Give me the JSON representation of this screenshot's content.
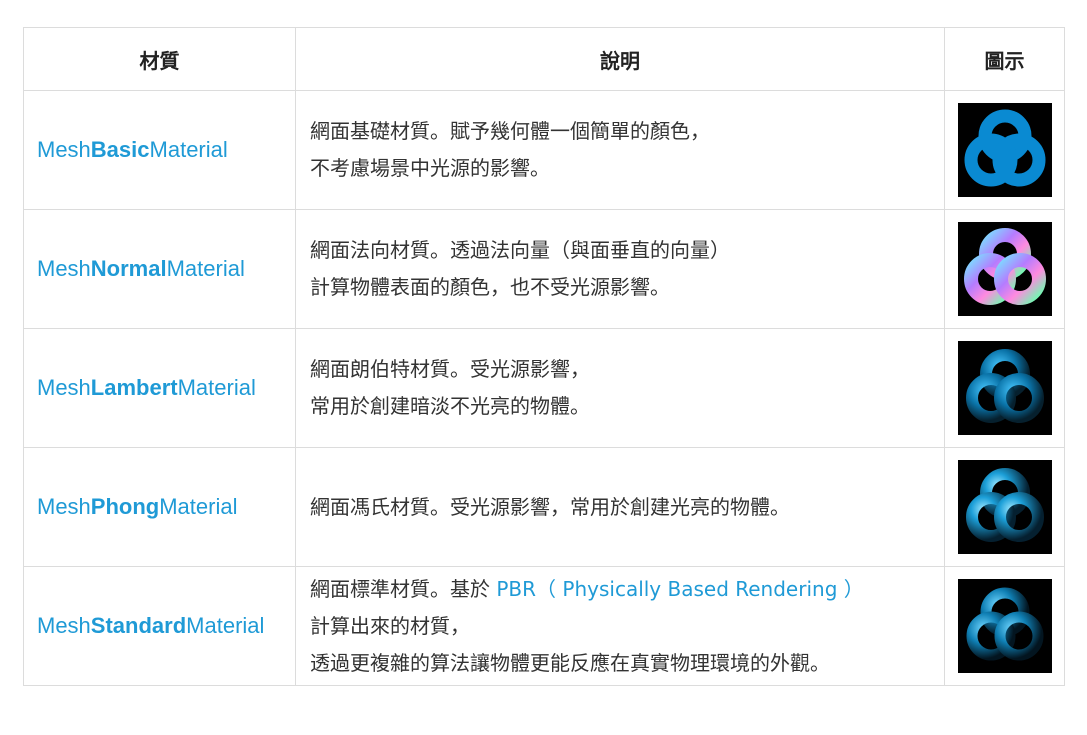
{
  "headers": {
    "material": "材質",
    "description": "說明",
    "image": "圖示"
  },
  "rows": [
    {
      "name_prefix": "Mesh",
      "name_bold": "Basic",
      "name_suffix": "Material",
      "desc_lines": [
        "網面基礎材質。賦予幾何體一個簡單的顏色，",
        "不考慮場景中光源的影響。"
      ],
      "image_icon": "torus-knot-basic-icon"
    },
    {
      "name_prefix": "Mesh",
      "name_bold": "Normal",
      "name_suffix": "Material",
      "desc_lines": [
        "網面法向材質。透過法向量（與面垂直的向量）",
        "計算物體表面的顏色，也不受光源影響。"
      ],
      "image_icon": "torus-knot-normal-icon"
    },
    {
      "name_prefix": "Mesh",
      "name_bold": "Lambert",
      "name_suffix": "Material",
      "desc_lines": [
        "網面朗伯特材質。受光源影響，",
        "常用於創建暗淡不光亮的物體。"
      ],
      "image_icon": "torus-knot-lambert-icon"
    },
    {
      "name_prefix": "Mesh",
      "name_bold": "Phong",
      "name_suffix": "Material",
      "desc_lines": [
        "網面馮氏材質。受光源影響，常用於創建光亮的物體。"
      ],
      "image_icon": "torus-knot-phong-icon"
    },
    {
      "name_prefix": "Mesh",
      "name_bold": "Standard",
      "name_suffix": "Material",
      "desc_line1_prefix": "網面標準材質。基於 ",
      "desc_link": "PBR（ Physically Based Rendering ）",
      "desc_lines": [
        "計算出來的材質，",
        "透過更複雜的算法讓物體更能反應在真實物理環境的外觀。"
      ],
      "image_icon": "torus-knot-standard-icon"
    }
  ],
  "colors": {
    "link": "#1f9ad6",
    "text": "#333333",
    "border": "#dcdcdc",
    "basic_fill": "#0a8ad2",
    "thumb_bg": "#000000"
  }
}
